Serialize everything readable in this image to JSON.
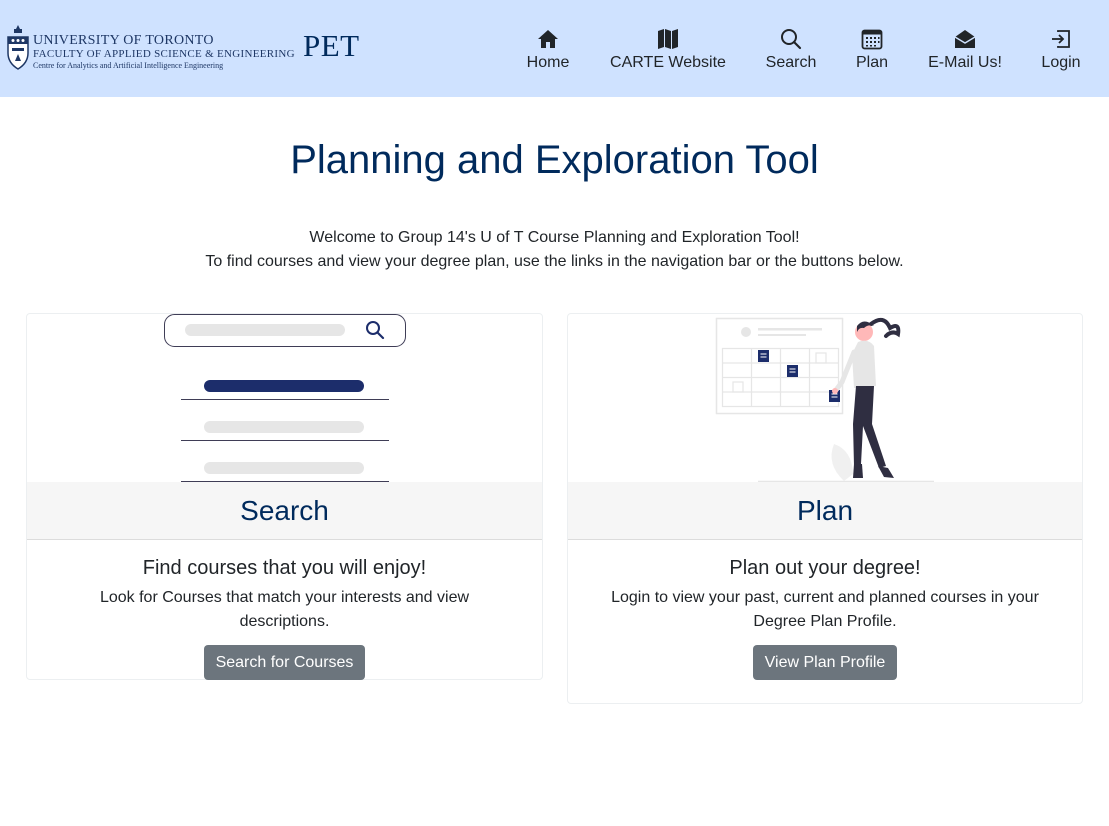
{
  "navbar": {
    "logo": {
      "line1": "UNIVERSITY OF TORONTO",
      "line2": "FACULTY OF APPLIED SCIENCE & ENGINEERING",
      "line3": "Centre for Analytics and Artificial Intelligence Engineering"
    },
    "brand": "PET",
    "items": [
      {
        "label": "Home",
        "icon": "home-icon"
      },
      {
        "label": "CARTE Website",
        "icon": "map-icon"
      },
      {
        "label": "Search",
        "icon": "search-icon"
      },
      {
        "label": "Plan",
        "icon": "calendar-icon"
      },
      {
        "label": "E-Mail Us!",
        "icon": "envelope-icon"
      },
      {
        "label": "Login",
        "icon": "login-icon"
      }
    ]
  },
  "main": {
    "title": "Planning and Exploration Tool",
    "intro_line1": "Welcome to Group 14's U of T Course Planning and Exploration Tool!",
    "intro_line2": "To find courses and view your degree plan, use the links in the navigation bar or the buttons below."
  },
  "cards": {
    "search": {
      "header": "Search",
      "subtitle": "Find courses that you will enjoy!",
      "text": "Look for Courses that match your interests and view descriptions.",
      "button": "Search for Courses"
    },
    "plan": {
      "header": "Plan",
      "subtitle": "Plan out your degree!",
      "text": "Login to view your past, current and planned courses in your Degree Plan Profile.",
      "button": "View Plan Profile"
    }
  },
  "colors": {
    "navbar_bg": "#cfe2ff",
    "heading": "#002a5c",
    "button": "#6c757d",
    "accent_navy": "#1c2d6b"
  }
}
